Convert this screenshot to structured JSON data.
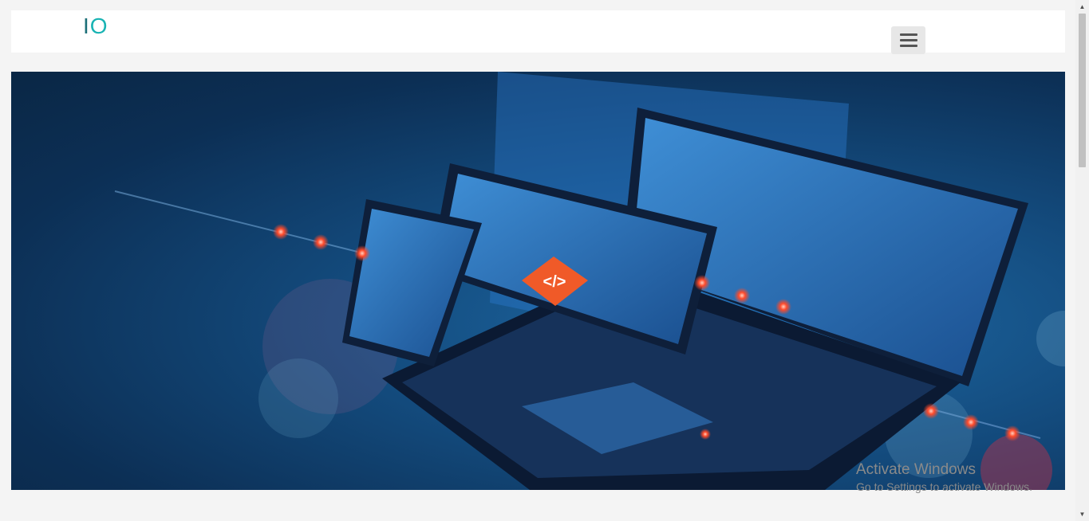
{
  "brand": {
    "logo_text_part1": "I",
    "logo_text_part2": "O"
  },
  "hero": {
    "image": "laptop-tablet-phone-code-illustration",
    "code_badge": "</>"
  },
  "icons": {
    "menu": "hamburger-menu-icon",
    "scroll_up": "chevron-up-icon",
    "scroll_down": "chevron-down-icon"
  },
  "watermark": {
    "title": "Activate Windows",
    "subtitle": "Go to Settings to activate Windows."
  },
  "colors": {
    "accent": "#19b3b3",
    "hero_dark": "#0c2f55",
    "badge": "#f05a28"
  }
}
